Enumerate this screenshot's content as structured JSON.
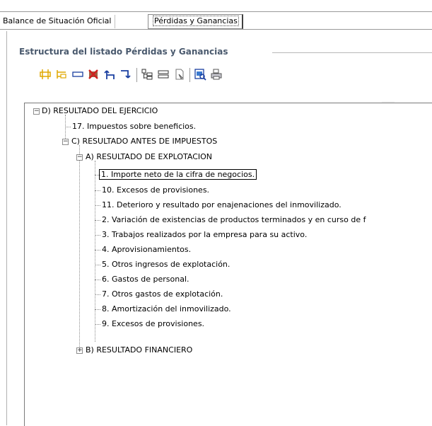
{
  "tabs": [
    {
      "label": "Balance de Situación Oficial"
    },
    {
      "label": "Pérdidas y Ganancias"
    }
  ],
  "group_title": "Estructura del listado Pérdidas y Ganancias",
  "toolbar": [
    {
      "icon": "insert-sibling-icon"
    },
    {
      "icon": "insert-child-icon"
    },
    {
      "icon": "rename-icon"
    },
    {
      "icon": "delete-icon"
    },
    {
      "icon": "move-up-icon"
    },
    {
      "icon": "move-down-icon"
    },
    {
      "icon": "expand-all-icon"
    },
    {
      "icon": "collapse-all-icon"
    },
    {
      "icon": "copy-icon"
    },
    {
      "icon": "preview-icon"
    },
    {
      "icon": "print-icon"
    }
  ],
  "tree": [
    {
      "label": "D) RESULTADO DEL EJERCICIO",
      "expander": "minus"
    },
    {
      "label": "17. Impuestos sobre beneficios."
    },
    {
      "label": "C) RESULTADO ANTES DE IMPUESTOS",
      "expander": "minus"
    },
    {
      "label": "A) RESULTADO DE EXPLOTACION",
      "expander": "minus"
    },
    {
      "label": "1. Importe neto de la cifra de negocios.",
      "selected": true
    },
    {
      "label": "10. Excesos de provisiones."
    },
    {
      "label": "11. Deterioro y resultado por enajenaciones del inmovilizado."
    },
    {
      "label": "2. Variación de existencias de productos terminados y en curso de f"
    },
    {
      "label": "3. Trabajos realizados por la empresa para su activo."
    },
    {
      "label": "4. Aprovisionamientos."
    },
    {
      "label": "5. Otros ingresos de explotación."
    },
    {
      "label": "6. Gastos de personal."
    },
    {
      "label": "7. Otros gastos de explotación."
    },
    {
      "label": "8. Amortización del inmovilizado."
    },
    {
      "label": "9. Excesos de provisiones."
    },
    {
      "label": "B) RESULTADO FINANCIERO",
      "expander": "plus"
    }
  ],
  "colors": {
    "group_title": "#4a5a6e",
    "icon_yellow": "#f0c000",
    "icon_blue": "#1a3fa0",
    "icon_red": "#d02020"
  }
}
